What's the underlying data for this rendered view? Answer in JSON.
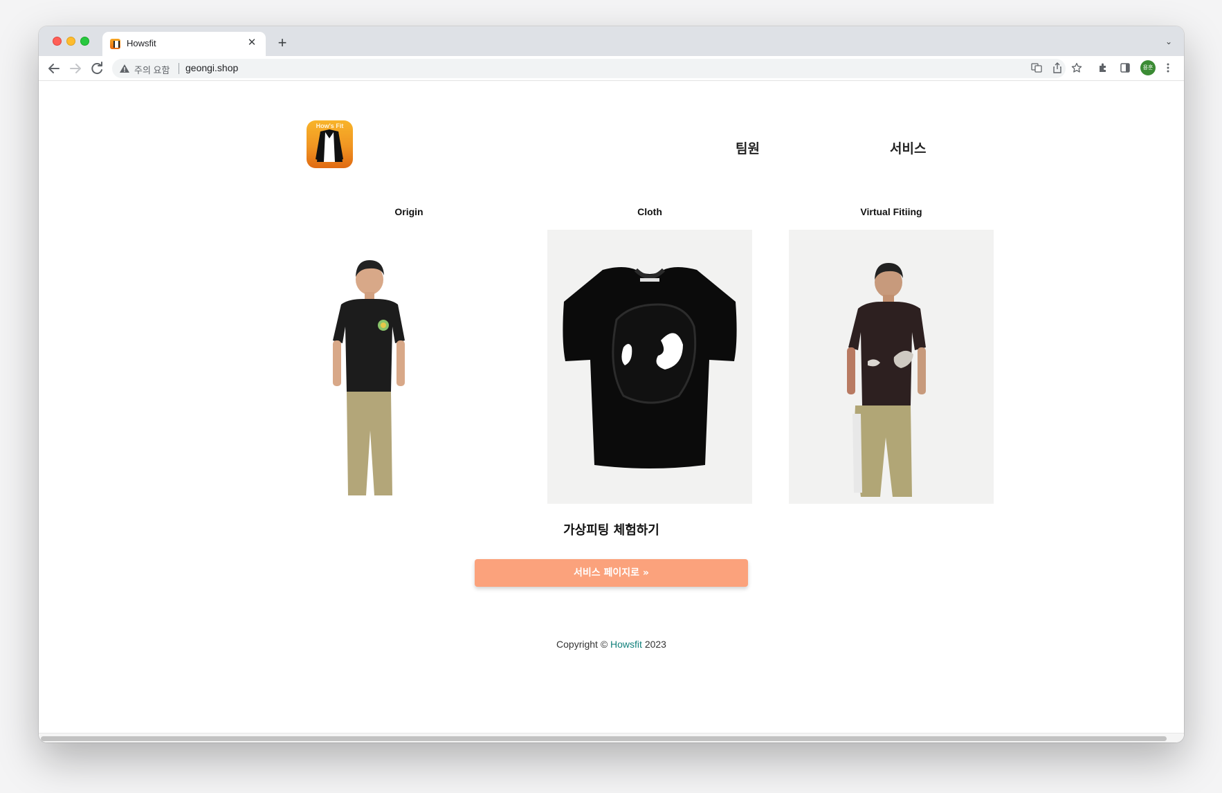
{
  "browser": {
    "tab_title": "Howsfit",
    "tab_close": "✕",
    "new_tab": "+",
    "tab_menu": "⌄",
    "security_warning": "주의 요함",
    "url": "geongi.shop",
    "profile_initials": "용훈"
  },
  "site": {
    "logo_text": "How's Fit",
    "nav": [
      "팀원",
      "서비스"
    ]
  },
  "fitting": {
    "columns": [
      {
        "label": "Origin"
      },
      {
        "label": "Cloth"
      },
      {
        "label": "Virtual Fitiing"
      }
    ]
  },
  "cta": {
    "heading": "가상피팅 체험하기",
    "button_label": "서비스 페이지로 »"
  },
  "footer": {
    "prefix": "Copyright © ",
    "link_text": "Howsfit",
    "suffix": " 2023"
  },
  "colors": {
    "button": "#fba27c",
    "footer_link": "#11807b",
    "logo": "#f09522"
  }
}
